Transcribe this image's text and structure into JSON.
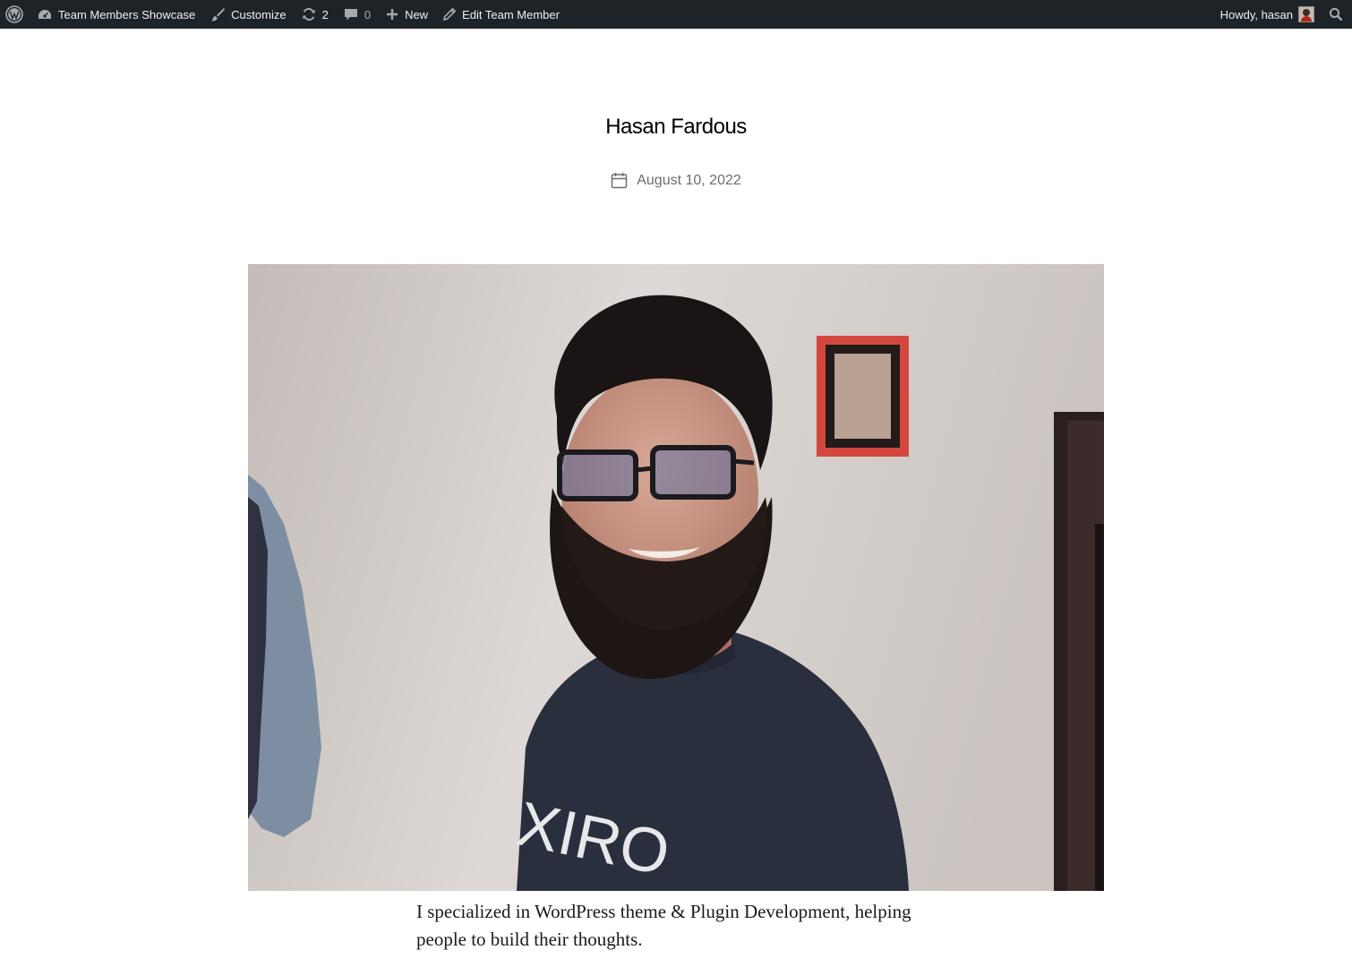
{
  "adminbar": {
    "site_name": "Team Members Showcase",
    "customize": "Customize",
    "updates_count": "2",
    "comments_count": "0",
    "new_label": "New",
    "edit_label": "Edit Team Member",
    "howdy": "Howdy, hasan"
  },
  "post": {
    "title": "Hasan Fardous",
    "date": "August 10, 2022",
    "content": "I specialized in WordPress theme & Plugin Development, helping people to build their thoughts."
  },
  "icons": {
    "wp": "wordpress-logo-icon",
    "site": "dashboard-icon",
    "customize": "paintbrush-icon",
    "updates": "updates-icon",
    "comments": "comment-bubble-icon",
    "new": "plus-icon",
    "edit": "pencil-icon",
    "search": "search-icon",
    "calendar": "calendar-icon"
  },
  "colors": {
    "adminbar_bg": "#1d2327",
    "adminbar_text": "#f0f0f1",
    "meta_text": "#6d6d6d"
  }
}
